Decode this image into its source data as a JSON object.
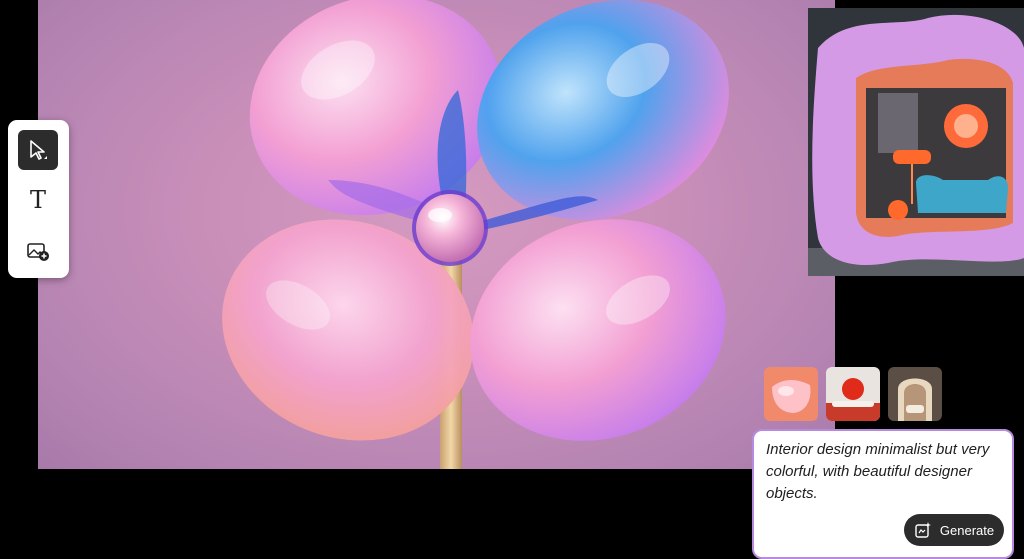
{
  "toolbar": {
    "tools": [
      {
        "name": "select",
        "icon": "cursor-arrow-icon",
        "selected": true
      },
      {
        "name": "text",
        "icon": "text-t-icon",
        "glyph": "T"
      },
      {
        "name": "add-image",
        "icon": "image-add-icon"
      }
    ]
  },
  "canvas": {
    "main_image": "glossy-bubble-flower-artwork",
    "side_image": "pink-blob-interior-storefront"
  },
  "suggestions": [
    {
      "thumb": "pink-glass-object-thumbnail"
    },
    {
      "thumb": "red-circle-interior-thumbnail"
    },
    {
      "thumb": "arched-lounge-interior-thumbnail"
    }
  ],
  "prompt": {
    "text": "Interior design minimalist but very colorful, with beautiful designer objects.",
    "generate_label": "Generate",
    "generate_icon": "sparkle-generate-icon"
  },
  "colors": {
    "toolbar_selected": "#2c2c2c",
    "prompt_border": "#b78ae0",
    "generate_button": "#2c2c2c"
  }
}
